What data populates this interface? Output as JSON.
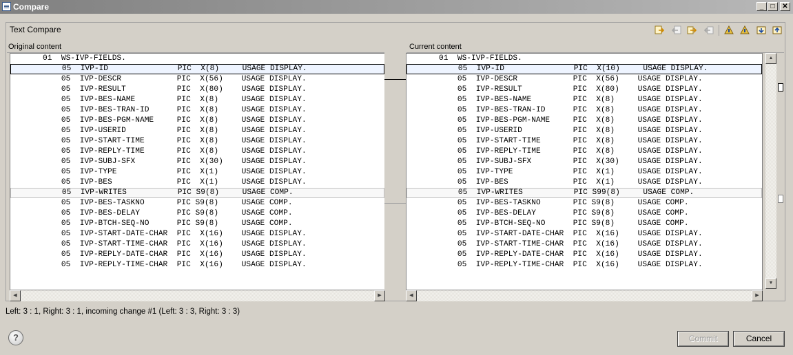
{
  "window": {
    "title": "Compare"
  },
  "panel": {
    "title": "Text Compare"
  },
  "panes": {
    "left_label": "Original content",
    "right_label": "Current content"
  },
  "left_lines": [
    "",
    "       01  WS-IVP-FIELDS.",
    "           05  IVP-ID               PIC  X(8)     USAGE DISPLAY.",
    "           05  IVP-DESCR            PIC  X(56)    USAGE DISPLAY.",
    "           05  IVP-RESULT           PIC  X(80)    USAGE DISPLAY.",
    "           05  IVP-BES-NAME         PIC  X(8)     USAGE DISPLAY.",
    "           05  IVP-BES-TRAN-ID      PIC  X(8)     USAGE DISPLAY.",
    "           05  IVP-BES-PGM-NAME     PIC  X(8)     USAGE DISPLAY.",
    "           05  IVP-USERID           PIC  X(8)     USAGE DISPLAY.",
    "           05  IVP-START-TIME       PIC  X(8)     USAGE DISPLAY.",
    "           05  IVP-REPLY-TIME       PIC  X(8)     USAGE DISPLAY.",
    "           05  IVP-SUBJ-SFX         PIC  X(30)    USAGE DISPLAY.",
    "           05  IVP-TYPE             PIC  X(1)     USAGE DISPLAY.",
    "           05  IVP-BES              PIC  X(1)     USAGE DISPLAY.",
    "           05  IVP-WRITES           PIC S9(8)     USAGE COMP.",
    "           05  IVP-BES-TASKNO       PIC S9(8)     USAGE COMP.",
    "           05  IVP-BES-DELAY        PIC S9(8)     USAGE COMP.",
    "           05  IVP-BTCH-SEQ-NO      PIC S9(8)     USAGE COMP.",
    "           05  IVP-START-DATE-CHAR  PIC  X(16)    USAGE DISPLAY.",
    "           05  IVP-START-TIME-CHAR  PIC  X(16)    USAGE DISPLAY.",
    "           05  IVP-REPLY-DATE-CHAR  PIC  X(16)    USAGE DISPLAY.",
    "           05  IVP-REPLY-TIME-CHAR  PIC  X(16)    USAGE DISPLAY."
  ],
  "right_lines": [
    "",
    "       01  WS-IVP-FIELDS.",
    "           05  IVP-ID               PIC  X(10)     USAGE DISPLAY.",
    "           05  IVP-DESCR            PIC  X(56)    USAGE DISPLAY.",
    "           05  IVP-RESULT           PIC  X(80)    USAGE DISPLAY.",
    "           05  IVP-BES-NAME         PIC  X(8)     USAGE DISPLAY.",
    "           05  IVP-BES-TRAN-ID      PIC  X(8)     USAGE DISPLAY.",
    "           05  IVP-BES-PGM-NAME     PIC  X(8)     USAGE DISPLAY.",
    "           05  IVP-USERID           PIC  X(8)     USAGE DISPLAY.",
    "           05  IVP-START-TIME       PIC  X(8)     USAGE DISPLAY.",
    "           05  IVP-REPLY-TIME       PIC  X(8)     USAGE DISPLAY.",
    "           05  IVP-SUBJ-SFX         PIC  X(30)    USAGE DISPLAY.",
    "           05  IVP-TYPE             PIC  X(1)     USAGE DISPLAY.",
    "           05  IVP-BES              PIC  X(1)     USAGE DISPLAY.",
    "           05  IVP-WRITES           PIC S99(8)     USAGE COMP.",
    "           05  IVP-BES-TASKNO       PIC S9(8)     USAGE COMP.",
    "           05  IVP-BES-DELAY        PIC S9(8)     USAGE COMP.",
    "           05  IVP-BTCH-SEQ-NO      PIC S9(8)     USAGE COMP.",
    "           05  IVP-START-DATE-CHAR  PIC  X(16)    USAGE DISPLAY.",
    "           05  IVP-START-TIME-CHAR  PIC  X(16)    USAGE DISPLAY.",
    "           05  IVP-REPLY-DATE-CHAR  PIC  X(16)    USAGE DISPLAY.",
    "           05  IVP-REPLY-TIME-CHAR  PIC  X(16)    USAGE DISPLAY."
  ],
  "changed_lines": [
    2,
    14
  ],
  "status": "Left: 3 : 1, Right: 3 : 1, incoming change #1 (Left: 3 : 3, Right: 3 : 3)",
  "buttons": {
    "commit": "Commit",
    "cancel": "Cancel",
    "help": "?"
  },
  "titlebar_buttons": {
    "minimize": "_",
    "maximize": "□",
    "close": "✕"
  },
  "toolbar_icons": [
    "copy-all-left-to-right-icon",
    "copy-all-right-to-left-icon",
    "copy-current-left-to-right-icon",
    "copy-current-right-to-left-icon",
    "next-difference-icon",
    "previous-difference-icon",
    "next-change-icon",
    "previous-change-icon"
  ]
}
